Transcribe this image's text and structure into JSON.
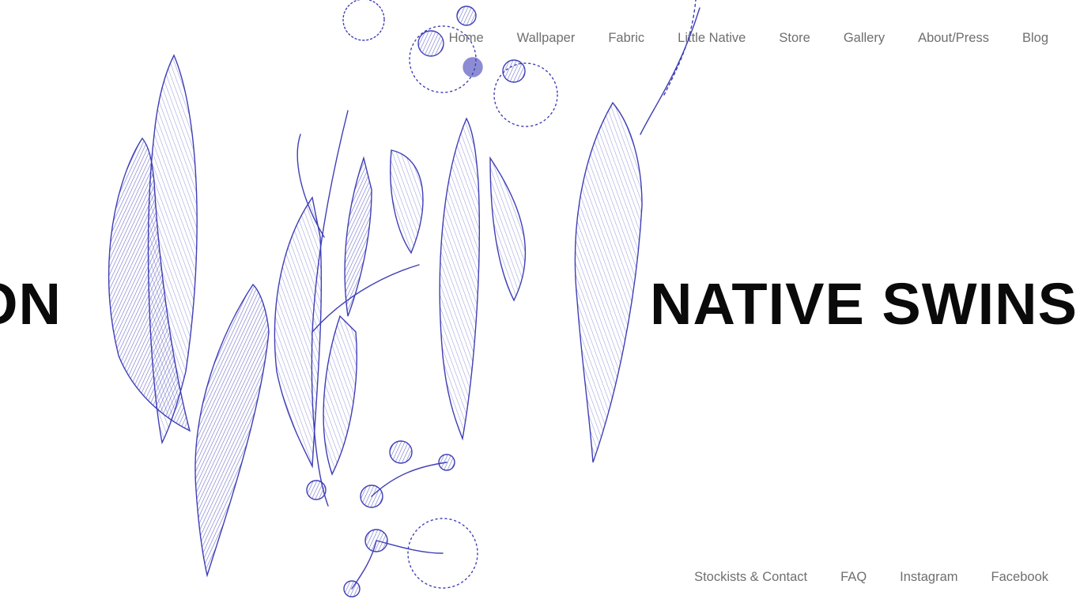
{
  "nav": {
    "items": [
      {
        "label": "Home"
      },
      {
        "label": "Wallpaper"
      },
      {
        "label": "Fabric"
      },
      {
        "label": "Little Native"
      },
      {
        "label": "Store"
      },
      {
        "label": "Gallery"
      },
      {
        "label": "About/Press"
      },
      {
        "label": "Blog"
      }
    ]
  },
  "hero": {
    "marquee_left": "ON",
    "marquee_right": "NATIVE SWINSO"
  },
  "footer_nav": {
    "items": [
      {
        "label": "Stockists & Contact"
      },
      {
        "label": "FAQ"
      },
      {
        "label": "Instagram"
      },
      {
        "label": "Facebook"
      }
    ]
  },
  "colors": {
    "illustration_ink": "#2a2ab0",
    "nav_text": "#6f6f6f",
    "marquee_text": "#0a0a0a"
  },
  "illustration": "eucalyptus-branch-drawing"
}
